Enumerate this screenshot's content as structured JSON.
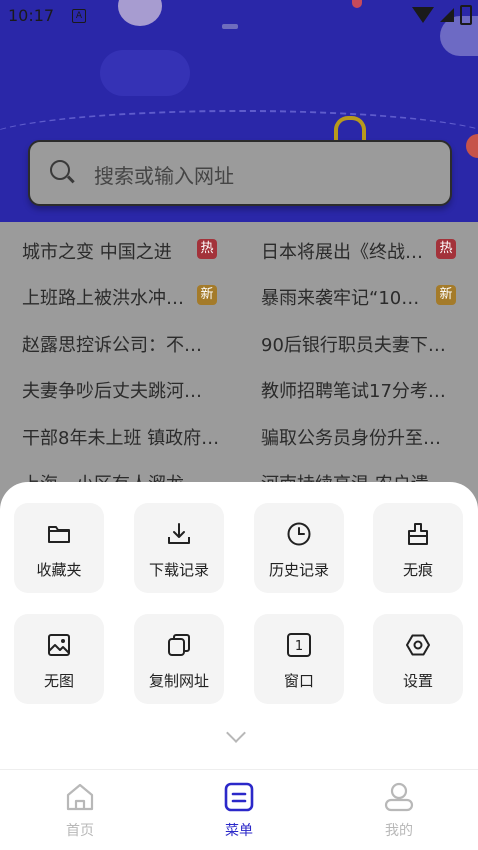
{
  "statusbar": {
    "time": "10:17",
    "notification_glyph": "A"
  },
  "search": {
    "placeholder": "搜索或输入网址"
  },
  "hot_list": [
    {
      "title": "城市之变 中国之进",
      "badge": "热",
      "badge_type": "hot"
    },
    {
      "title": "日本将展出《终战…",
      "badge": "热",
      "badge_type": "hot"
    },
    {
      "title": "上班路上被洪水冲…",
      "badge": "新",
      "badge_type": "new"
    },
    {
      "title": "暴雨来袭牢记“10…",
      "badge": "新",
      "badge_type": "new"
    },
    {
      "title": "赵露思控诉公司：不…",
      "badge": "",
      "badge_type": ""
    },
    {
      "title": "90后银行职员夫妻下…",
      "badge": "",
      "badge_type": ""
    },
    {
      "title": "夫妻争吵后丈夫跳河…",
      "badge": "",
      "badge_type": ""
    },
    {
      "title": "教师招聘笔试17分考…",
      "badge": "",
      "badge_type": ""
    },
    {
      "title": "干部8年未上班 镇政府…",
      "badge": "",
      "badge_type": ""
    },
    {
      "title": "骗取公务员身份升至…",
      "badge": "",
      "badge_type": ""
    },
    {
      "title": "上海一小区有人溜龙",
      "badge": "",
      "badge_type": ""
    },
    {
      "title": "河南持续高温 农户遗",
      "badge": "",
      "badge_type": ""
    }
  ],
  "menu": {
    "tiles": [
      {
        "label": "收藏夹",
        "icon": "folder-icon"
      },
      {
        "label": "下载记录",
        "icon": "download-icon"
      },
      {
        "label": "历史记录",
        "icon": "clock-icon"
      },
      {
        "label": "无痕",
        "icon": "brush-icon"
      },
      {
        "label": "无图",
        "icon": "image-icon"
      },
      {
        "label": "复制网址",
        "icon": "copy-icon"
      },
      {
        "label": "窗口",
        "icon": "window-icon"
      },
      {
        "label": "设置",
        "icon": "settings-icon"
      }
    ],
    "window_count": "1"
  },
  "navbar": {
    "items": [
      {
        "label": "首页",
        "icon": "home-icon",
        "active": false
      },
      {
        "label": "菜单",
        "icon": "menu-icon",
        "active": true
      },
      {
        "label": "我的",
        "icon": "profile-icon",
        "active": false
      }
    ]
  },
  "colors": {
    "hero": "#2a27a8",
    "accent": "#2b28c9",
    "inactive": "#b8b8b8",
    "badge_hot": "#a3323a",
    "badge_new": "#a47b2a"
  }
}
